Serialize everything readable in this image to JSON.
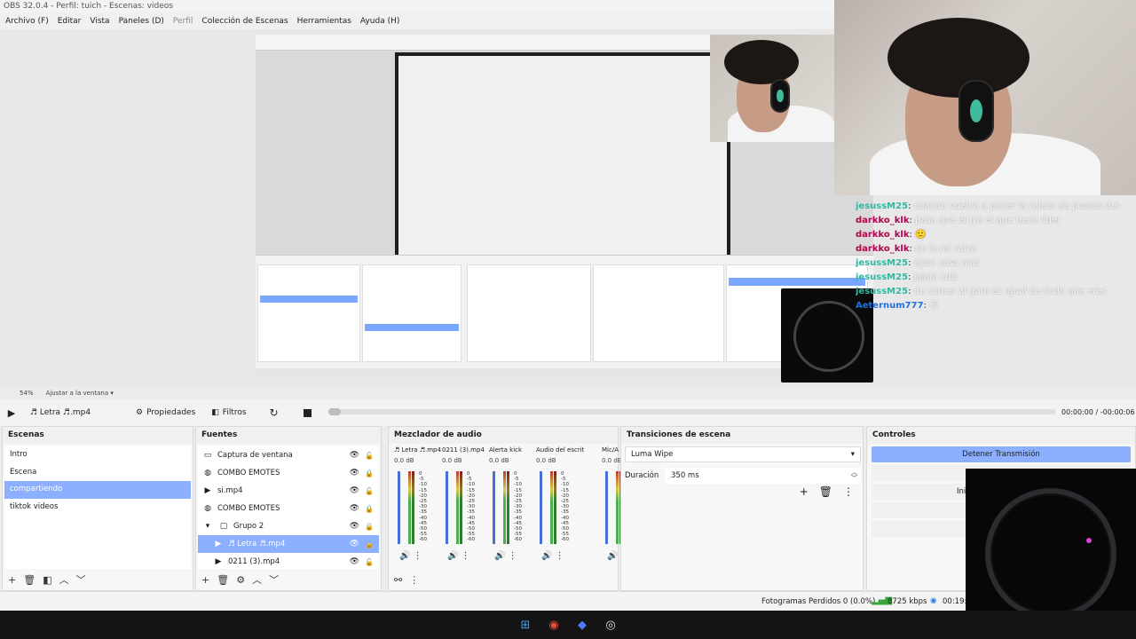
{
  "window": {
    "title": "OBS 32.0.4 - Perfil: tuich - Escenas: videos"
  },
  "menu": [
    {
      "label": "Archivo (F)",
      "disabled": false
    },
    {
      "label": "Editar",
      "disabled": false
    },
    {
      "label": "Vista",
      "disabled": false
    },
    {
      "label": "Paneles (D)",
      "disabled": false
    },
    {
      "label": "Perfil",
      "disabled": true
    },
    {
      "label": "Colección de Escenas",
      "disabled": false
    },
    {
      "label": "Herramientas",
      "disabled": false
    },
    {
      "label": "Ayuda (H)",
      "disabled": false
    }
  ],
  "zoom": {
    "level": "54%",
    "fit_label": "Ajustar a la ventana"
  },
  "toolbar": {
    "source_name": "♬ Letra ♬.mp4",
    "properties_label": "Propiedades",
    "filters_label": "Filtros",
    "time": "00:00:00  /  -00:00:06"
  },
  "scenes": {
    "title": "Escenas",
    "items": [
      "Intro",
      "Escena",
      "compartiendo",
      "tiktok videos"
    ],
    "selected": "compartiendo"
  },
  "sources": {
    "title": "Fuentes",
    "items": [
      {
        "name": "Captura de ventana",
        "icon": "window-capture-icon",
        "locked": false,
        "sel": false,
        "indent": 0
      },
      {
        "name": "COMBO EMOTES",
        "icon": "browser-icon",
        "locked": true,
        "sel": false,
        "indent": 0
      },
      {
        "name": "si.mp4",
        "icon": "media-icon",
        "locked": false,
        "sel": false,
        "indent": 0
      },
      {
        "name": "COMBO EMOTES",
        "icon": "browser-icon",
        "locked": true,
        "sel": false,
        "indent": 0
      },
      {
        "name": "Grupo 2",
        "icon": "group-icon",
        "locked": true,
        "sel": false,
        "indent": 0
      },
      {
        "name": "♬ Letra ♬.mp4",
        "icon": "media-icon",
        "locked": false,
        "sel": true,
        "indent": 1
      },
      {
        "name": "0211 (3).mp4",
        "icon": "media-icon",
        "locked": false,
        "sel": false,
        "indent": 1
      }
    ]
  },
  "mixer": {
    "title": "Mezclador de audio",
    "channels": [
      {
        "name": "♬ Letra ♬.mp4",
        "db": "0.0 dB"
      },
      {
        "name": "0211 (3).mp4",
        "db": "0.0 dB"
      },
      {
        "name": "Alerta kick",
        "db": "0.0 dB"
      },
      {
        "name": "Audio del escritorio",
        "db": "0.0 dB"
      },
      {
        "name": "Mic/A",
        "db": "0.0 dB"
      }
    ],
    "scale": [
      "0",
      "-5",
      "-10",
      "-15",
      "-20",
      "-25",
      "-30",
      "-35",
      "-40",
      "-45",
      "-50",
      "-55",
      "-60"
    ]
  },
  "transitions": {
    "title": "Transiciones de escena",
    "selected": "Luma Wipe",
    "duration_label": "Duración",
    "duration_value": "350 ms"
  },
  "controls": {
    "title": "Controles",
    "stop_stream_label": "Detener Transmisión",
    "partial_label": "Inic"
  },
  "status": {
    "dropped_frames": "Fotogramas Perdidos 0 (0.0%)",
    "bitrate": "8725 kbps",
    "time": "00:19:"
  },
  "chat": [
    {
      "user": "jesussM25",
      "color": "#2fb9a3",
      "msg": "cuando vuelva a poner la ruleta de puntos del canal de sergiolanes"
    },
    {
      "user": "darkko_klk",
      "color": "#b8004a",
      "msg": "pasa que el Jyo el que tiene lider"
    },
    {
      "user": "darkko_klk",
      "color": "#b8004a",
      "msg": "🙂"
    },
    {
      "user": "darkko_klk",
      "color": "#b8004a",
      "msg": "no lo mi salva"
    },
    {
      "user": "jesussM25",
      "color": "#2fb9a3",
      "msg": "ajam cosa alas"
    },
    {
      "user": "jesussM25",
      "color": "#2fb9a3",
      "msg": "jajaja xdd"
    },
    {
      "user": "jesussM25",
      "color": "#2fb9a3",
      "msg": "de comer al gato es igual de lindo que eres"
    },
    {
      "user": "Aeternum777",
      "color": "#1f6fe0",
      "msg": "😏"
    }
  ],
  "colors": {
    "accent": "#8cb0ff",
    "fader": "#4a6fd8",
    "meter_green": "#4caf50",
    "meter_red": "#c0392b"
  }
}
